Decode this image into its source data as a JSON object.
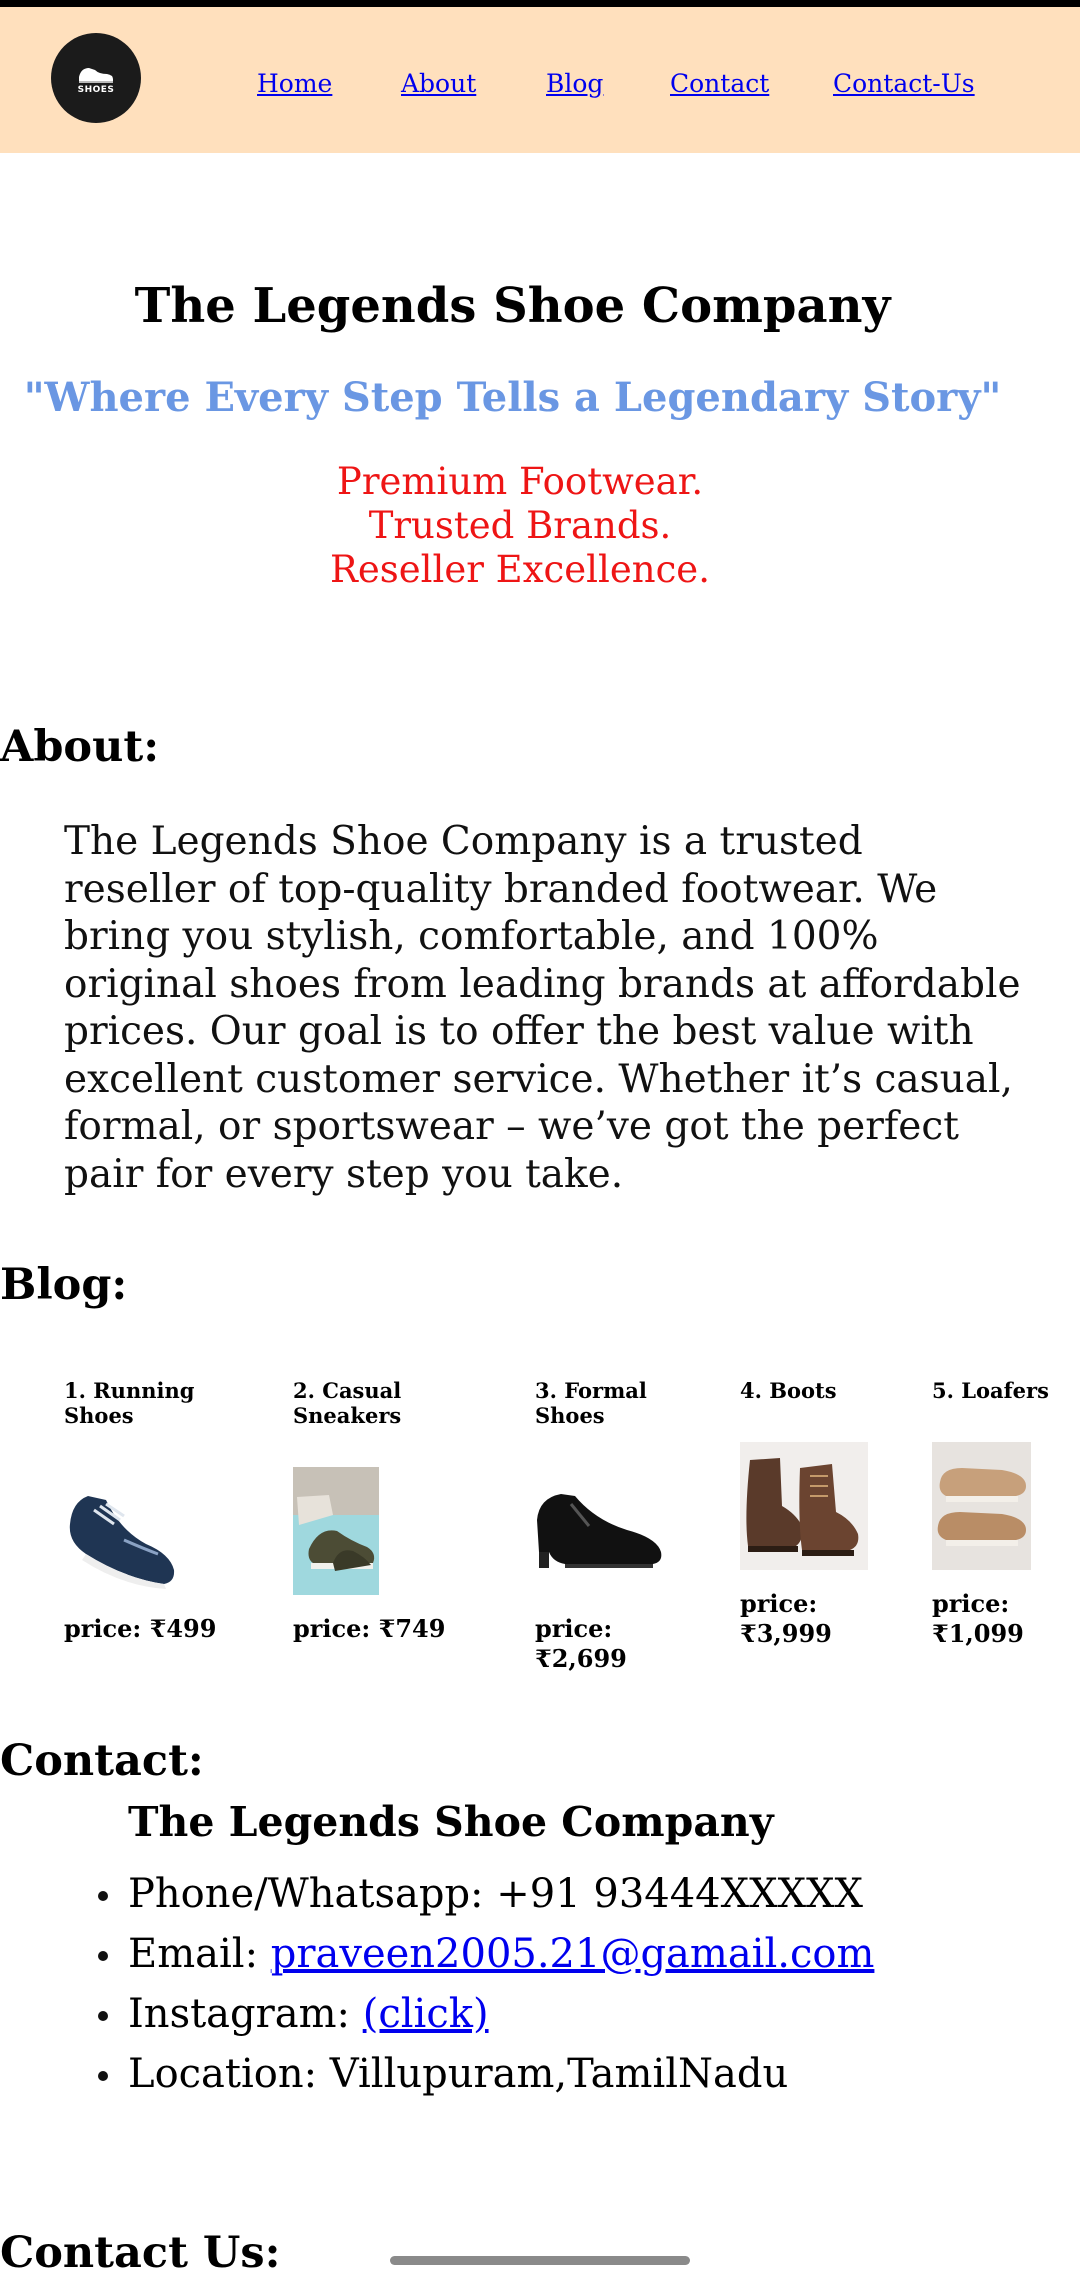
{
  "nav": {
    "logo_text": "SHOES",
    "links": [
      "Home",
      "About",
      "Blog",
      "Contact",
      "Contact-Us"
    ]
  },
  "hero": {
    "title": "The Legends Shoe Company",
    "tagline": "\"Where Every Step Tells a Legendary Story\"",
    "lines": [
      "Premium Footwear.",
      "Trusted Brands.",
      "Reseller Excellence."
    ]
  },
  "about": {
    "heading": "About:",
    "text": "The Legends Shoe Company is a trusted reseller of top-quality branded footwear. We bring you stylish, comfortable, and 100% original shoes from leading brands at affordable prices. Our goal is to offer the best value with excellent customer service. Whether it’s casual, formal, or sportswear – we’ve got the perfect pair for every step you take."
  },
  "blog": {
    "heading": "Blog:",
    "products": [
      {
        "name": "1. Running Shoes",
        "price": "price: ₹499",
        "icon": "running-shoe-icon"
      },
      {
        "name": "2. Casual Sneakers",
        "price": "price: ₹749",
        "icon": "sneaker-icon"
      },
      {
        "name": "3. Formal Shoes",
        "price": "price: ₹2,699",
        "icon": "formal-shoe-icon"
      },
      {
        "name": "4. Boots",
        "price": "price: ₹3,999",
        "icon": "boot-icon"
      },
      {
        "name": "5. Loafers",
        "price": "price: ₹1,099",
        "icon": "loafer-icon"
      }
    ]
  },
  "contact": {
    "heading": "Contact:",
    "company": "The Legends Shoe Company",
    "phone_label": "Phone/Whatsapp: +91 93444XXXXX",
    "email_label": "Email: ",
    "email_link": "praveen2005.21@gamail.com",
    "instagram_label": "Instagram: ",
    "instagram_link": "(click)",
    "location": "Location: Villupuram,TamilNadu"
  },
  "contact_us": {
    "heading": "Contact Us:"
  }
}
